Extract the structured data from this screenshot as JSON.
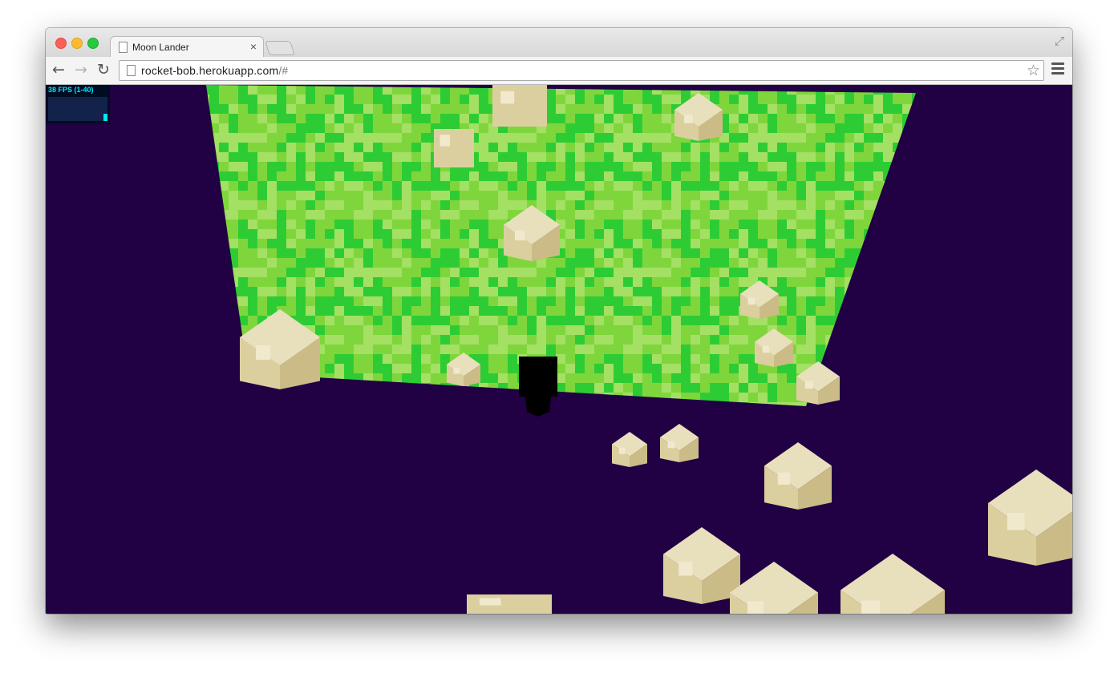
{
  "browser": {
    "tab_title": "Moon Lander",
    "tab_close_label": "×",
    "fullscreen_label": "⤢",
    "nav": {
      "back": "←",
      "forward": "→",
      "reload": "↻"
    },
    "url_host": "rocket-bob.herokuapp.com",
    "url_path": "/#",
    "star_label": "☆"
  },
  "stats": {
    "fps_label": "38 FPS (1-40)",
    "current_fps": 38,
    "min_fps": 1,
    "max_fps": 40
  },
  "scene": {
    "colors": {
      "sky": "#210044",
      "grass_a": "#2ecc34",
      "grass_b": "#7fd63c",
      "grass_c": "#a3e063",
      "block_top": "#e8dfbd",
      "block_left": "#dccf9f",
      "block_right": "#cbbb86",
      "block_patch": "#f1e9ce",
      "rocket": "#000000"
    },
    "icons": [
      "document-icon",
      "close-icon",
      "fullscreen-icon",
      "back-arrow-icon",
      "forward-arrow-icon",
      "reload-icon",
      "star-icon",
      "menu-icon"
    ]
  }
}
